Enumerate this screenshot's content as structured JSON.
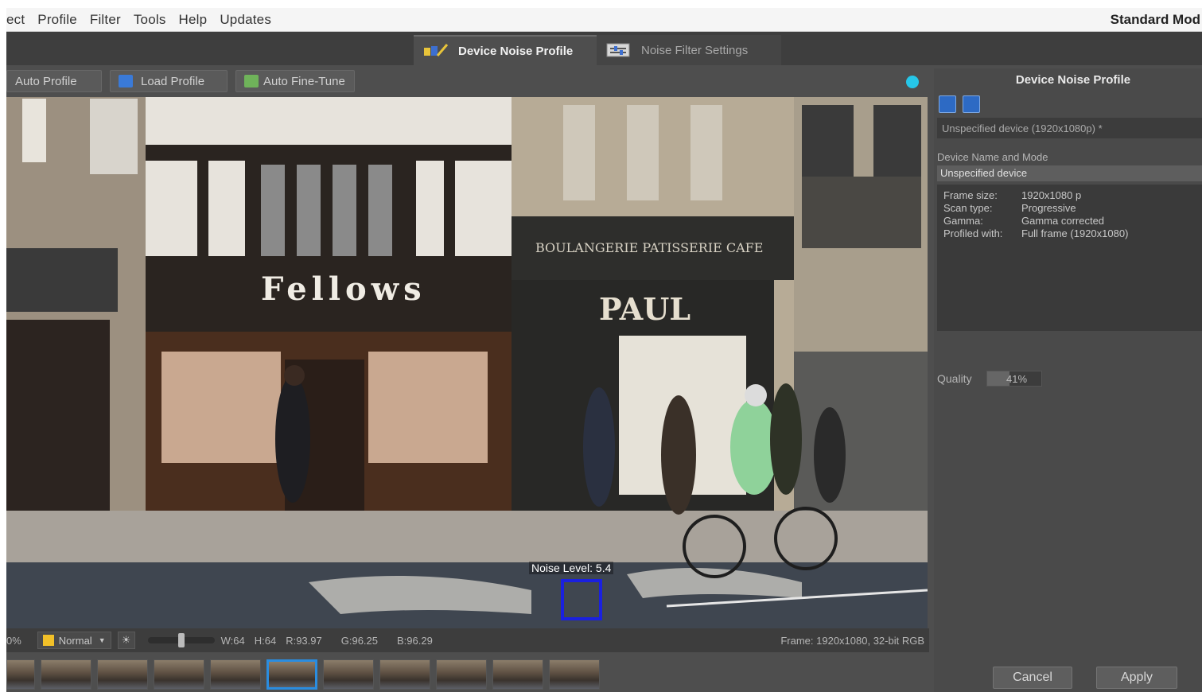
{
  "menu": {
    "items": [
      "ect",
      "Profile",
      "Filter",
      "Tools",
      "Help",
      "Updates"
    ],
    "mode": "Standard Mod"
  },
  "tabs": [
    {
      "label": "Device Noise Profile",
      "active": true,
      "icon": "profile-icon"
    },
    {
      "label": "Noise Filter Settings",
      "active": false,
      "icon": "filter-settings-icon"
    }
  ],
  "toolbar": {
    "auto_profile": "Auto Profile",
    "load_profile": "Load Profile",
    "auto_fine_tune": "Auto Fine-Tune",
    "status_color": "#26c6e8"
  },
  "viewer": {
    "noise_label": "Noise Level: 5.4"
  },
  "statusbar": {
    "zoom": "0%",
    "mode": "Normal",
    "w": "W:64",
    "h": "H:64",
    "r": "R:93.97",
    "g": "G:96.25",
    "b": "B:96.29",
    "frame": "Frame: 1920x1080, 32-bit RGB"
  },
  "panel": {
    "title": "Device Noise Profile",
    "device": "Unspecified device (1920x1080p) *",
    "name_label": "Device Name and Mode",
    "name_value": "Unspecified device",
    "info": [
      {
        "k": "Frame size:",
        "v": "1920x1080 p"
      },
      {
        "k": "Scan type:",
        "v": "Progressive"
      },
      {
        "k": "Gamma:",
        "v": "Gamma corrected"
      },
      {
        "k": "Profiled with:",
        "v": "Full frame (1920x1080)"
      }
    ],
    "quality_label": "Quality",
    "quality_value": "41%",
    "quality_fraction": 0.41
  },
  "buttons": {
    "cancel": "Cancel",
    "apply": "Apply"
  },
  "filmstrip": {
    "count": 11,
    "selected_index": 4
  }
}
